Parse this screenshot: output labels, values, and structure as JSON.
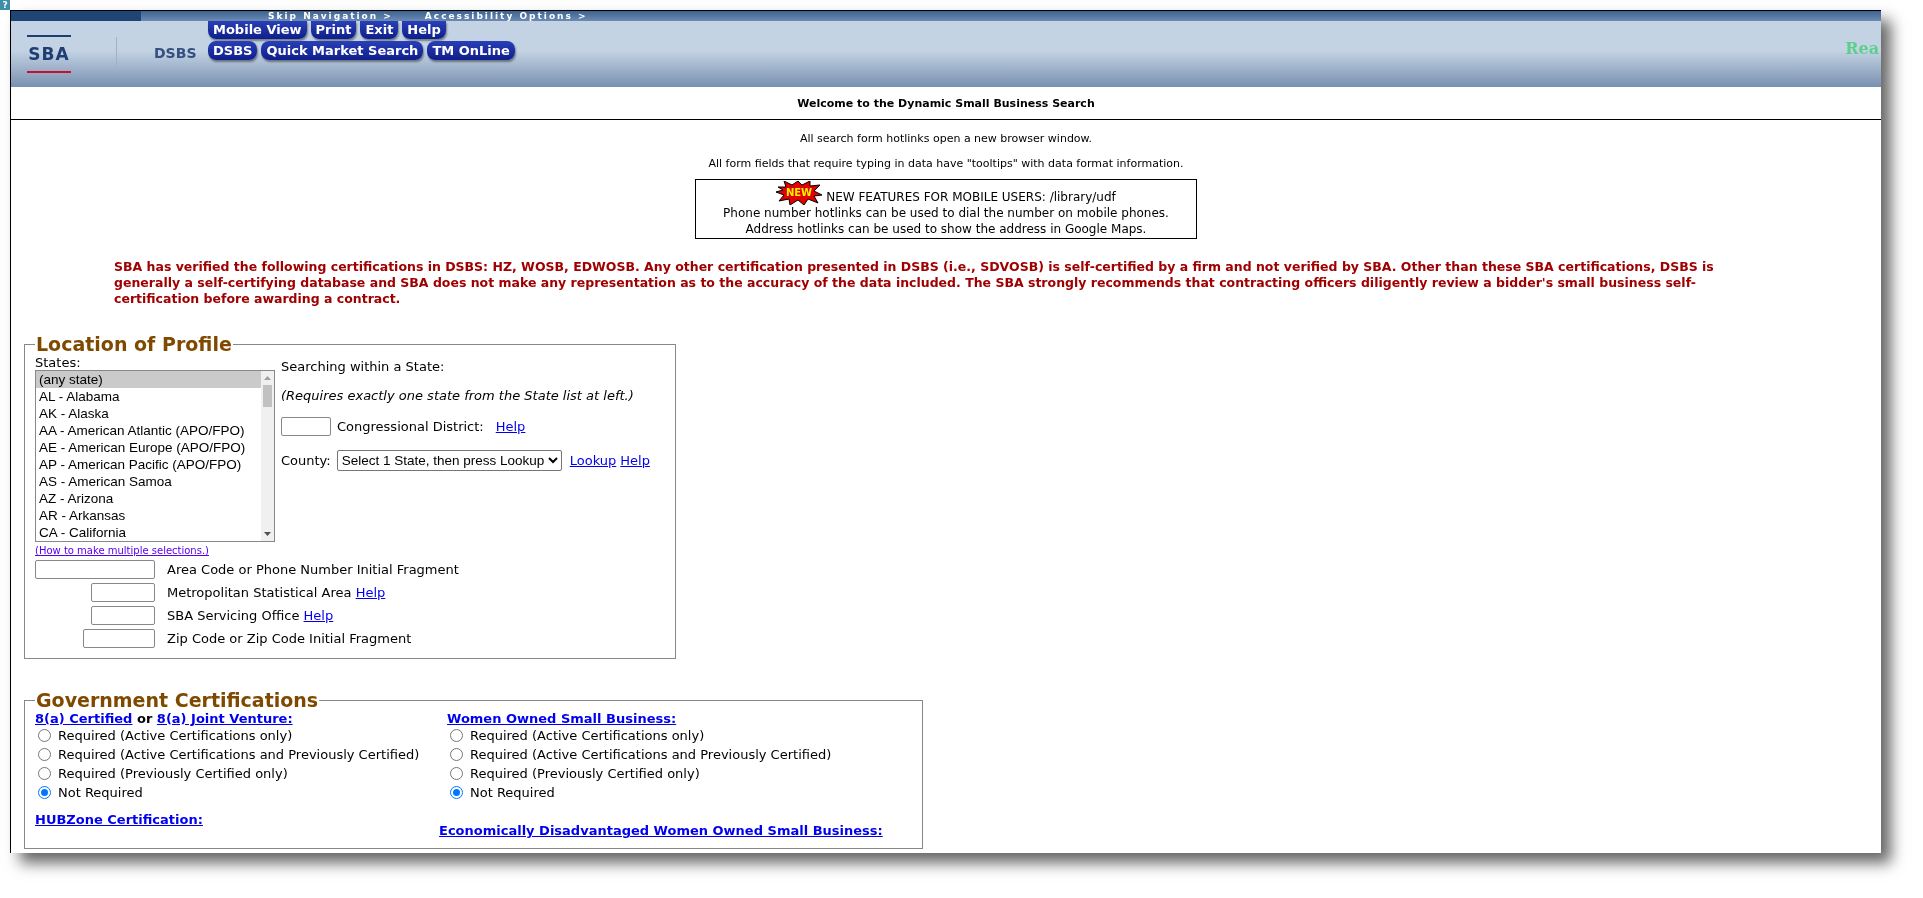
{
  "help_badge": "?",
  "header": {
    "skip_links": [
      "Skip Navigation >",
      "Accessibility Options >"
    ],
    "logo": "SBA",
    "app_name": "DSBS",
    "nav_rows": [
      [
        "Mobile View",
        "Print",
        "Exit",
        "Help"
      ],
      [
        "DSBS",
        "Quick Market Search",
        "TM OnLine"
      ]
    ],
    "right_text": "Rea"
  },
  "welcome": "Welcome to the Dynamic Small Business Search",
  "notes": [
    "All search form hotlinks open a new browser window.",
    "All form fields that require typing in data have \"tooltips\" with data format information."
  ],
  "new_features": {
    "badge": "NEW",
    "lines": [
      "NEW FEATURES FOR MOBILE USERS: /library/udf",
      "Phone number hotlinks can be used to dial the number on mobile phones.",
      "Address hotlinks can be used to show the address in Google Maps."
    ]
  },
  "disclaimer": "SBA has verified the following certifications in DSBS: HZ, WOSB, EDWOSB. Any other certification presented in DSBS (i.e., SDVOSB) is self-certified by a firm and not verified by SBA. Other than these SBA certifications, DSBS is generally a self-certifying database and SBA does not make any representation as to the accuracy of the data included. The SBA strongly recommends that contracting officers diligently review a bidder's small business self-certification before awarding a contract.",
  "location": {
    "title": "Location of Profile",
    "states_label": "States:",
    "states": [
      {
        "label": "(any state)",
        "selected": true
      },
      {
        "label": "AL - Alabama",
        "selected": false
      },
      {
        "label": "AK - Alaska",
        "selected": false
      },
      {
        "label": "AA - American Atlantic (APO/FPO)",
        "selected": false
      },
      {
        "label": "AE - American Europe (APO/FPO)",
        "selected": false
      },
      {
        "label": "AP - American Pacific (APO/FPO)",
        "selected": false
      },
      {
        "label": "AS - American Samoa",
        "selected": false
      },
      {
        "label": "AZ - Arizona",
        "selected": false
      },
      {
        "label": "AR - Arkansas",
        "selected": false
      },
      {
        "label": "CA - California",
        "selected": false
      }
    ],
    "multi_help": "(How to make multiple selections.)",
    "within_label": "Searching within a State:",
    "within_note": "(Requires exactly one state from the State list at left.)",
    "district": {
      "label": "Congressional District:",
      "help": "Help"
    },
    "county": {
      "label": "County:",
      "value": "Select 1 State, then press Lookup",
      "links": [
        "Lookup",
        "Help"
      ]
    },
    "fields": [
      {
        "kind": "wide",
        "label": "Area Code or Phone Number Initial Fragment"
      },
      {
        "kind": "short",
        "label": "Metropolitan Statistical Area",
        "help": "Help"
      },
      {
        "kind": "short",
        "label": "SBA Servicing Office",
        "help": "Help"
      },
      {
        "kind": "medium",
        "label": "Zip Code or Zip Code Initial Fragment"
      }
    ]
  },
  "certifications": {
    "title": "Government Certifications",
    "groups": [
      {
        "links": [
          "8(a) Certified",
          "8(a) Joint Venture:"
        ],
        "connector": "or",
        "options": [
          {
            "label": "Required (Active Certifications only)",
            "selected": false
          },
          {
            "label": "Required (Active Certifications and Previously Certified)",
            "selected": false
          },
          {
            "label": "Required (Previously Certified only)",
            "selected": false
          },
          {
            "label": "Not Required",
            "selected": true
          }
        ]
      },
      {
        "links": [
          "Women Owned Small Business:"
        ],
        "options": [
          {
            "label": "Required (Active Certifications only)",
            "selected": false
          },
          {
            "label": "Required (Active Certifications and Previously Certified)",
            "selected": false
          },
          {
            "label": "Required (Previously Certified only)",
            "selected": false
          },
          {
            "label": "Not Required",
            "selected": true
          }
        ]
      }
    ],
    "more_headings": [
      "HUBZone Certification:",
      "Economically Disadvantaged Women Owned Small Business:"
    ]
  }
}
